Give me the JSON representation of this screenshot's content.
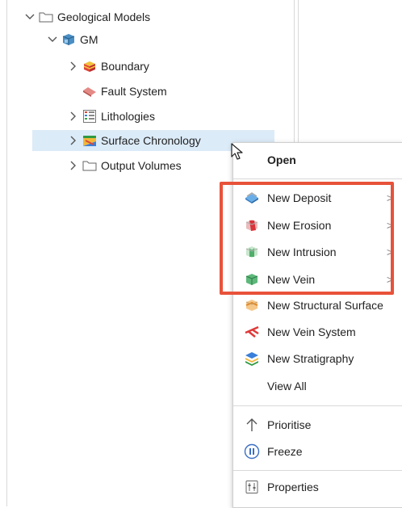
{
  "tree": {
    "items": [
      {
        "label": "Geological Models",
        "icon": "folder-icon",
        "chevron": "down"
      },
      {
        "label": "GM",
        "icon": "geological-model-icon",
        "chevron": "down"
      },
      {
        "label": "Boundary",
        "icon": "boundary-icon",
        "chevron": "right"
      },
      {
        "label": "Fault System",
        "icon": "fault-system-icon",
        "chevron": "none"
      },
      {
        "label": "Lithologies",
        "icon": "lithologies-icon",
        "chevron": "right"
      },
      {
        "label": "Surface Chronology",
        "icon": "surface-chronology-icon",
        "chevron": "right",
        "selected": true
      },
      {
        "label": "Output Volumes",
        "icon": "folder-icon",
        "chevron": "right"
      }
    ]
  },
  "menu": {
    "open": "Open",
    "new_deposit": "New Deposit",
    "new_erosion": "New Erosion",
    "new_intrusion": "New Intrusion",
    "new_vein": "New Vein",
    "new_structural_surface": "New Structural Surface",
    "new_vein_system": "New Vein System",
    "new_stratigraphy": "New Stratigraphy",
    "view_all": "View All",
    "prioritise": "Prioritise",
    "freeze": "Freeze",
    "properties": "Properties",
    "submenu_arrow": ">"
  },
  "colors": {
    "highlight": "#e8523a",
    "selection": "#dcebf8"
  }
}
